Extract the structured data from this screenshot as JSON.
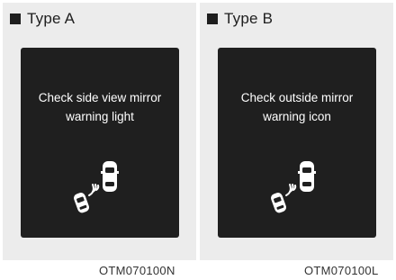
{
  "type_a": {
    "label": "Type A",
    "line1": "Check side view mirror",
    "line2": "warning light",
    "code": "OTM070100N"
  },
  "type_b": {
    "label": "Type B",
    "line1": "Check outside mirror",
    "line2": "warning icon",
    "code": "OTM070100L"
  },
  "icons": {
    "warning": "side-mirror-blind-spot-warning-icon"
  },
  "colors": {
    "panel": "#ececec",
    "screen": "#1f1f1f",
    "text_on_screen": "#ffffff"
  }
}
